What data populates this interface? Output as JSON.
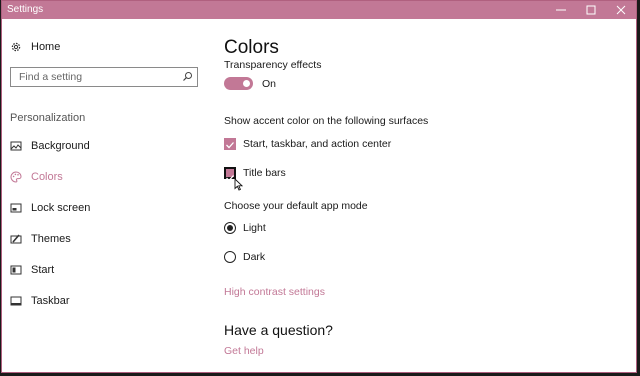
{
  "window": {
    "title": "Settings"
  },
  "sidebar": {
    "home_label": "Home",
    "search_placeholder": "Find a setting",
    "section_label": "Personalization",
    "items": [
      {
        "label": "Background",
        "icon": "picture-icon",
        "active": false
      },
      {
        "label": "Colors",
        "icon": "palette-icon",
        "active": true
      },
      {
        "label": "Lock screen",
        "icon": "lock-screen-icon",
        "active": false
      },
      {
        "label": "Themes",
        "icon": "brush-icon",
        "active": false
      },
      {
        "label": "Start",
        "icon": "start-menu-icon",
        "active": false
      },
      {
        "label": "Taskbar",
        "icon": "taskbar-icon",
        "active": false
      }
    ]
  },
  "main": {
    "title": "Colors",
    "transparency": {
      "label": "Transparency effects",
      "state_label": "On",
      "on": true
    },
    "accent_heading": "Show accent color on the following surfaces",
    "checkboxes": [
      {
        "label": "Start, taskbar, and action center",
        "checked": true
      },
      {
        "label": "Title bars",
        "checked": true
      }
    ],
    "app_mode_heading": "Choose your default app mode",
    "radios": [
      {
        "label": "Light",
        "selected": true
      },
      {
        "label": "Dark",
        "selected": false
      }
    ],
    "high_contrast_link": "High contrast settings",
    "question_heading": "Have a question?",
    "help_link": "Get help"
  },
  "colors": {
    "accent": "#c27896"
  }
}
